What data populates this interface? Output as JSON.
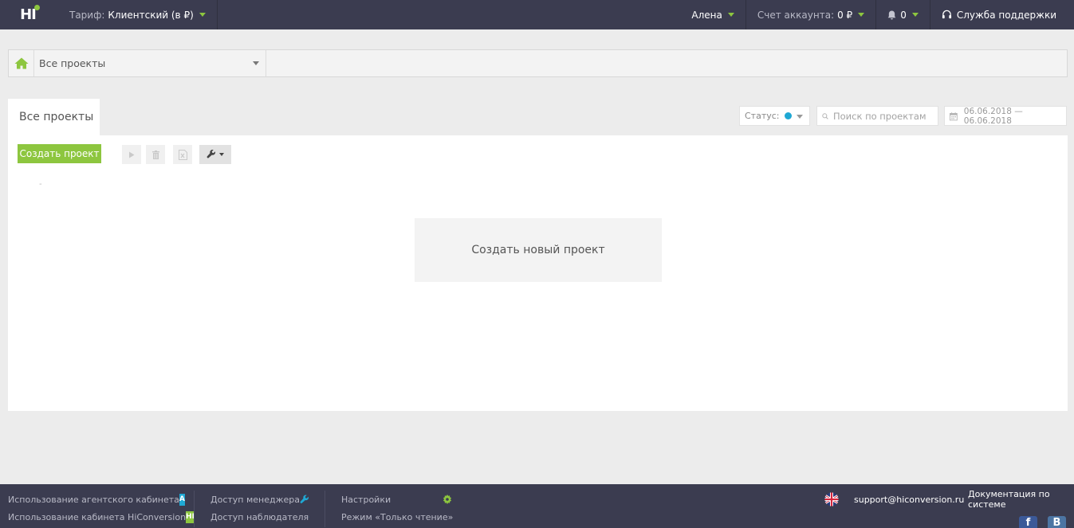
{
  "topbar": {
    "logo": "HI",
    "tariff_label": "Тариф:",
    "tariff_value": "Клиентский (в ₽)",
    "user_name": "Алена",
    "account_label": "Счет аккаунта:",
    "account_value": "0 ₽",
    "notifications": "0",
    "support": "Служба поддержки"
  },
  "breadcrumb": {
    "project_select": "Все проекты"
  },
  "tabs": {
    "active": "Все проекты"
  },
  "filters": {
    "status_label": "Статус:",
    "status_color": "#1fa8d4",
    "search_placeholder": "Поиск по проектам",
    "date_range": "06.06.2018 — 06.06.2018"
  },
  "toolbar": {
    "create_label": "Создать проект"
  },
  "main": {
    "dash": "-",
    "new_project": "Создать новый проект"
  },
  "footer": {
    "agent_usage": "Использование агентского кабинета",
    "agent_badge": "A",
    "hi_usage": "Использование кабинета HiConversion",
    "hi_badge": "HI",
    "manager_access": "Доступ менеджера",
    "observer_access": "Доступ наблюдателя",
    "settings": "Настройки",
    "readonly_mode": "Режим «Только чтение»",
    "support_email": "support@hiconversion.ru",
    "docs": "Документация по системе",
    "facebook": "f",
    "vk": "В"
  },
  "colors": {
    "topbar_bg": "#3b3c50",
    "accent_green": "#8dc63f",
    "accent_blue": "#1fa8d4",
    "accent_yellow": "#f2c200"
  }
}
